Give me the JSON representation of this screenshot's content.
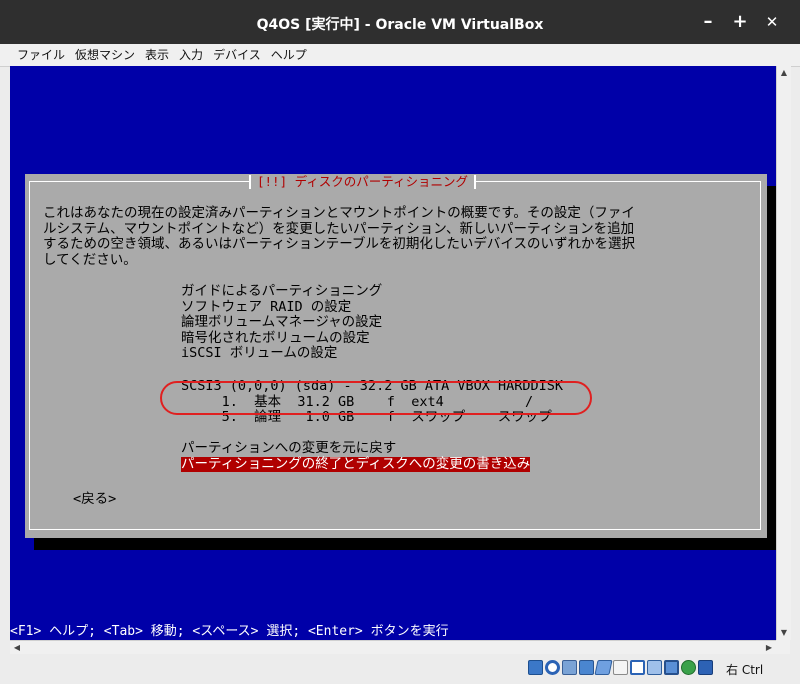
{
  "window": {
    "title": "Q4OS [実行中] - Oracle VM VirtualBox",
    "minimize_glyph": "–",
    "maximize_glyph": "+",
    "close_glyph": "✕"
  },
  "menubar": [
    "ファイル",
    "仮想マシン",
    "表示",
    "入力",
    "デバイス",
    "ヘルプ"
  ],
  "installer": {
    "dialog_title": "[!!] ディスクのパーティショニング",
    "description": [
      "これはあなたの現在の設定済みパーティションとマウントポイントの概要です。その設定（ファイ",
      "ルシステム、マウントポイントなど）を変更したいパーティション、新しいパーティションを追加",
      "するための空き領域、あるいはパーティションテーブルを初期化したいデバイスのいずれかを選択",
      "してください。"
    ],
    "options": [
      "ガイドによるパーティショニング",
      "ソフトウェア RAID の設定",
      "論理ボリュームマネージャの設定",
      "暗号化されたボリュームの設定",
      "iSCSI ボリュームの設定"
    ],
    "disk": {
      "label": "SCSI3 (0,0,0) (sda) - 32.2 GB ATA VBOX HARDDISK",
      "partitions": [
        "     1.  基本  31.2 GB    f  ext4          /",
        "     5.  論理   1.0 GB    f  スワップ    スワップ"
      ]
    },
    "undo_label": "パーティションへの変更を元に戻す",
    "finish_label": "パーティショニングの終了とディスクへの変更の書き込み",
    "back_label": "<戻る>",
    "help_line": "<F1> ヘルプ; <Tab> 移動; <スペース> 選択; <Enter> ボタンを実行"
  },
  "statusbar": {
    "host_key": "右 Ctrl",
    "icons": [
      "hard-disk-icon",
      "optical-drive-icon",
      "audio-icon",
      "network-icon",
      "usb-icon",
      "shared-folders-icon",
      "display-icon",
      "video-capture-icon",
      "cpu-icon",
      "mouse-integration-icon",
      "keyboard-icon"
    ]
  },
  "colors": {
    "vm_background": "#0000a8",
    "dialog_background": "#aaaaaa",
    "dialog_title": "#b00000",
    "selection": "#b00000",
    "highlight_ring": "#e02020"
  }
}
